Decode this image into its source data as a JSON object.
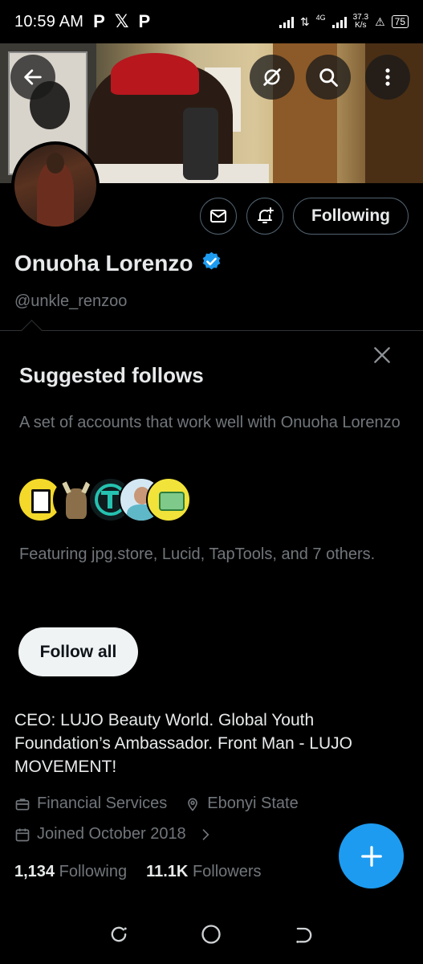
{
  "status_bar": {
    "time": "10:59 AM",
    "apps": [
      "P",
      "𝕏",
      "P"
    ],
    "network": "4G",
    "speed_value": "37.3",
    "speed_unit": "K/s",
    "battery": "75"
  },
  "profile": {
    "display_name": "Onuoha Lorenzo",
    "handle": "@unkle_renzoo",
    "following_button": "Following",
    "verified_color": "#1d9bf0"
  },
  "suggested": {
    "title": "Suggested follows",
    "description": "A set of accounts that work well with Onuoha Lorenzo",
    "featuring": "Featuring jpg.store, Lucid, TapTools, and 7 others.",
    "follow_all": "Follow all"
  },
  "bio": "CEO: LUJO Beauty World. Global Youth Foundation’s Ambassador. Front Man - LUJO MOVEMENT!",
  "meta": {
    "category": "Financial Services",
    "location": "Ebonyi State",
    "joined": "Joined October 2018"
  },
  "stats": {
    "following_count": "1,134",
    "following_label": "Following",
    "followers_count": "11.1K",
    "followers_label": "Followers"
  },
  "colors": {
    "accent": "#1d9bf0",
    "background": "#000000",
    "muted": "#71767b"
  },
  "icons": [
    "back-arrow-icon",
    "grok-icon",
    "search-icon",
    "more-vertical-icon",
    "mail-icon",
    "bell-plus-icon",
    "verified-badge-icon",
    "close-icon",
    "briefcase-icon",
    "location-pin-icon",
    "calendar-icon",
    "chevron-right-icon",
    "plus-icon",
    "recents-icon",
    "home-circle-icon",
    "back-nav-icon"
  ]
}
